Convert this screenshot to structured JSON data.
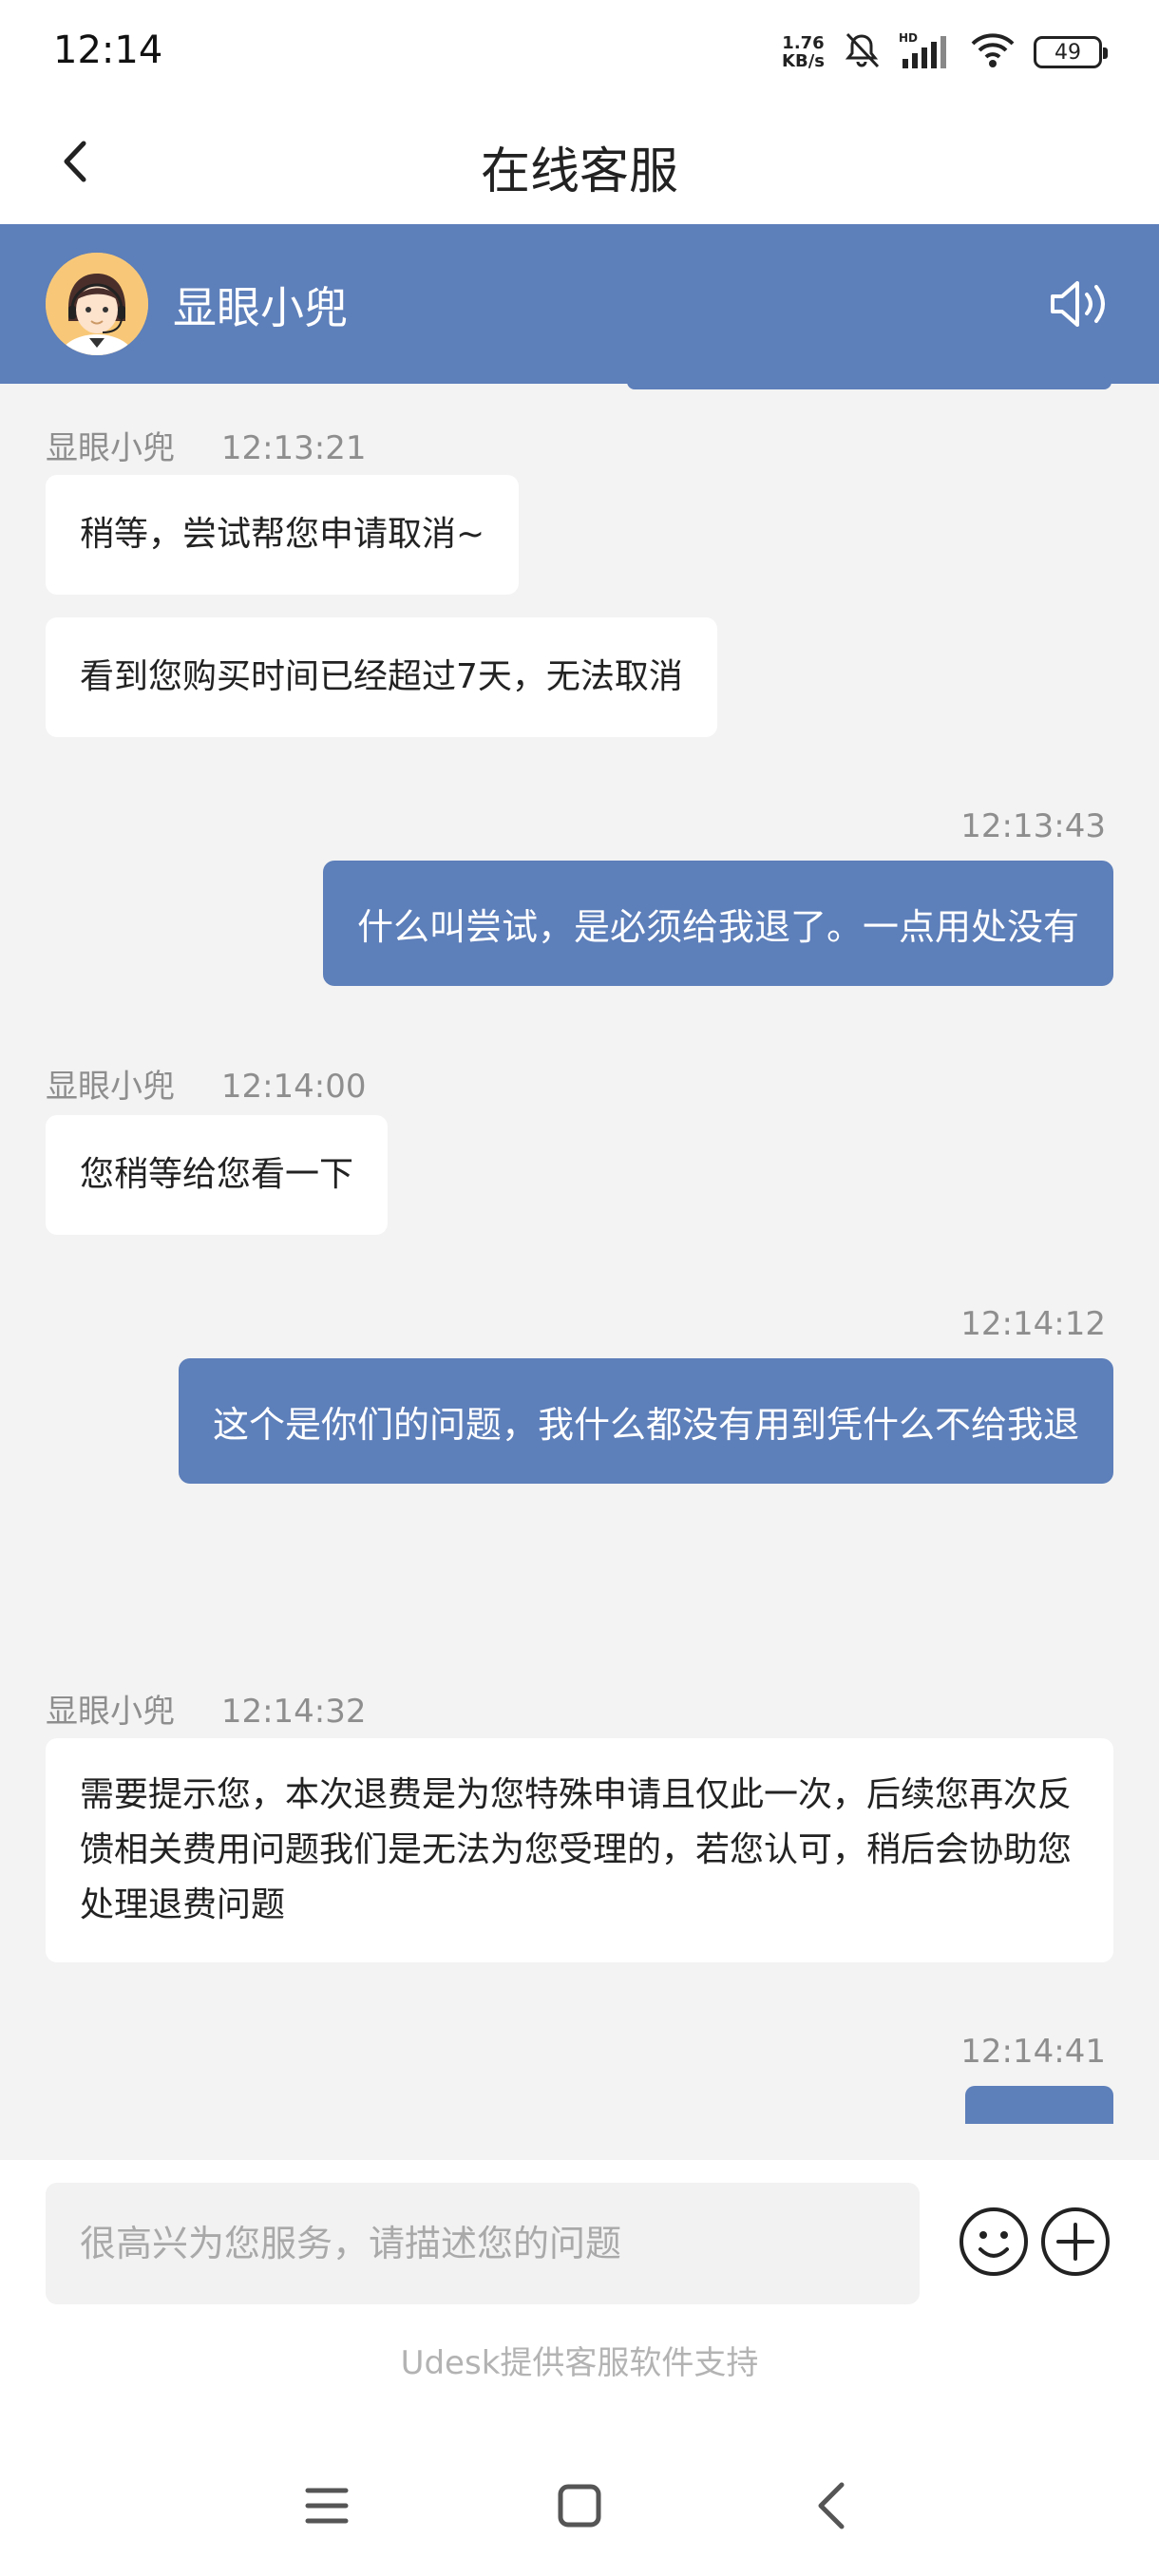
{
  "status": {
    "time": "12:14",
    "net_speed_value": "1.76",
    "net_speed_unit": "KB/s",
    "network": "HD",
    "battery": "49"
  },
  "nav": {
    "title": "在线客服",
    "back_icon": "chevron-left-icon"
  },
  "agent": {
    "name": "显眼小兜",
    "avatar_icon": "agent-headset-avatar",
    "speaker_icon": "speaker-icon"
  },
  "messages": [
    {
      "from": "agent",
      "sender": "显眼小兜",
      "time": "12:13:21",
      "texts": [
        "稍等，尝试帮您申请取消~",
        "看到您购买时间已经超过7天，无法取消"
      ]
    },
    {
      "from": "user",
      "time": "12:13:43",
      "text": "什么叫尝试，是必须给我退了。一点用处没有"
    },
    {
      "from": "agent",
      "sender": "显眼小兜",
      "time": "12:14:00",
      "texts": [
        "您稍等给您看一下"
      ]
    },
    {
      "from": "user",
      "time": "12:14:12",
      "text": "这个是你们的问题，我什么都没有用到凭什么不给我退"
    },
    {
      "from": "agent",
      "sender": "显眼小兜",
      "time": "12:14:32",
      "texts": [
        "需要提示您，本次退费是为您特殊申请且仅此一次，后续您再次反馈相关费用问题我们是无法为您受理的，若您认可，稍后会协助您处理退费问题"
      ]
    },
    {
      "from": "user",
      "time": "12:14:41",
      "text": ""
    }
  ],
  "input": {
    "placeholder": "很高兴为您服务，请描述您的问题",
    "emoji_icon": "smiley-icon",
    "plus_icon": "plus-circle-icon"
  },
  "footer": {
    "powered_by": "Udesk提供客服软件支持"
  },
  "colors": {
    "accent": "#5d7fba",
    "background": "#f3f3f3",
    "bubble_in": "#ffffff"
  }
}
